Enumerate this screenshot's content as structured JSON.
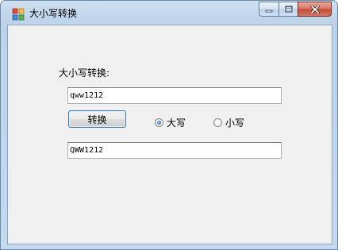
{
  "window": {
    "title": "大小写转换",
    "icon": "app-forms-icon",
    "caption_buttons": [
      "minimize-icon",
      "maximize-icon",
      "close-icon"
    ],
    "close_color": "#c24b33"
  },
  "form": {
    "label": "大小写转换:",
    "input_value": "qww1212",
    "convert_button": "转换",
    "radio_upper": {
      "label": "大写",
      "checked": true
    },
    "radio_lower": {
      "label": "小写",
      "checked": false
    },
    "output_value": "QWW1212"
  }
}
